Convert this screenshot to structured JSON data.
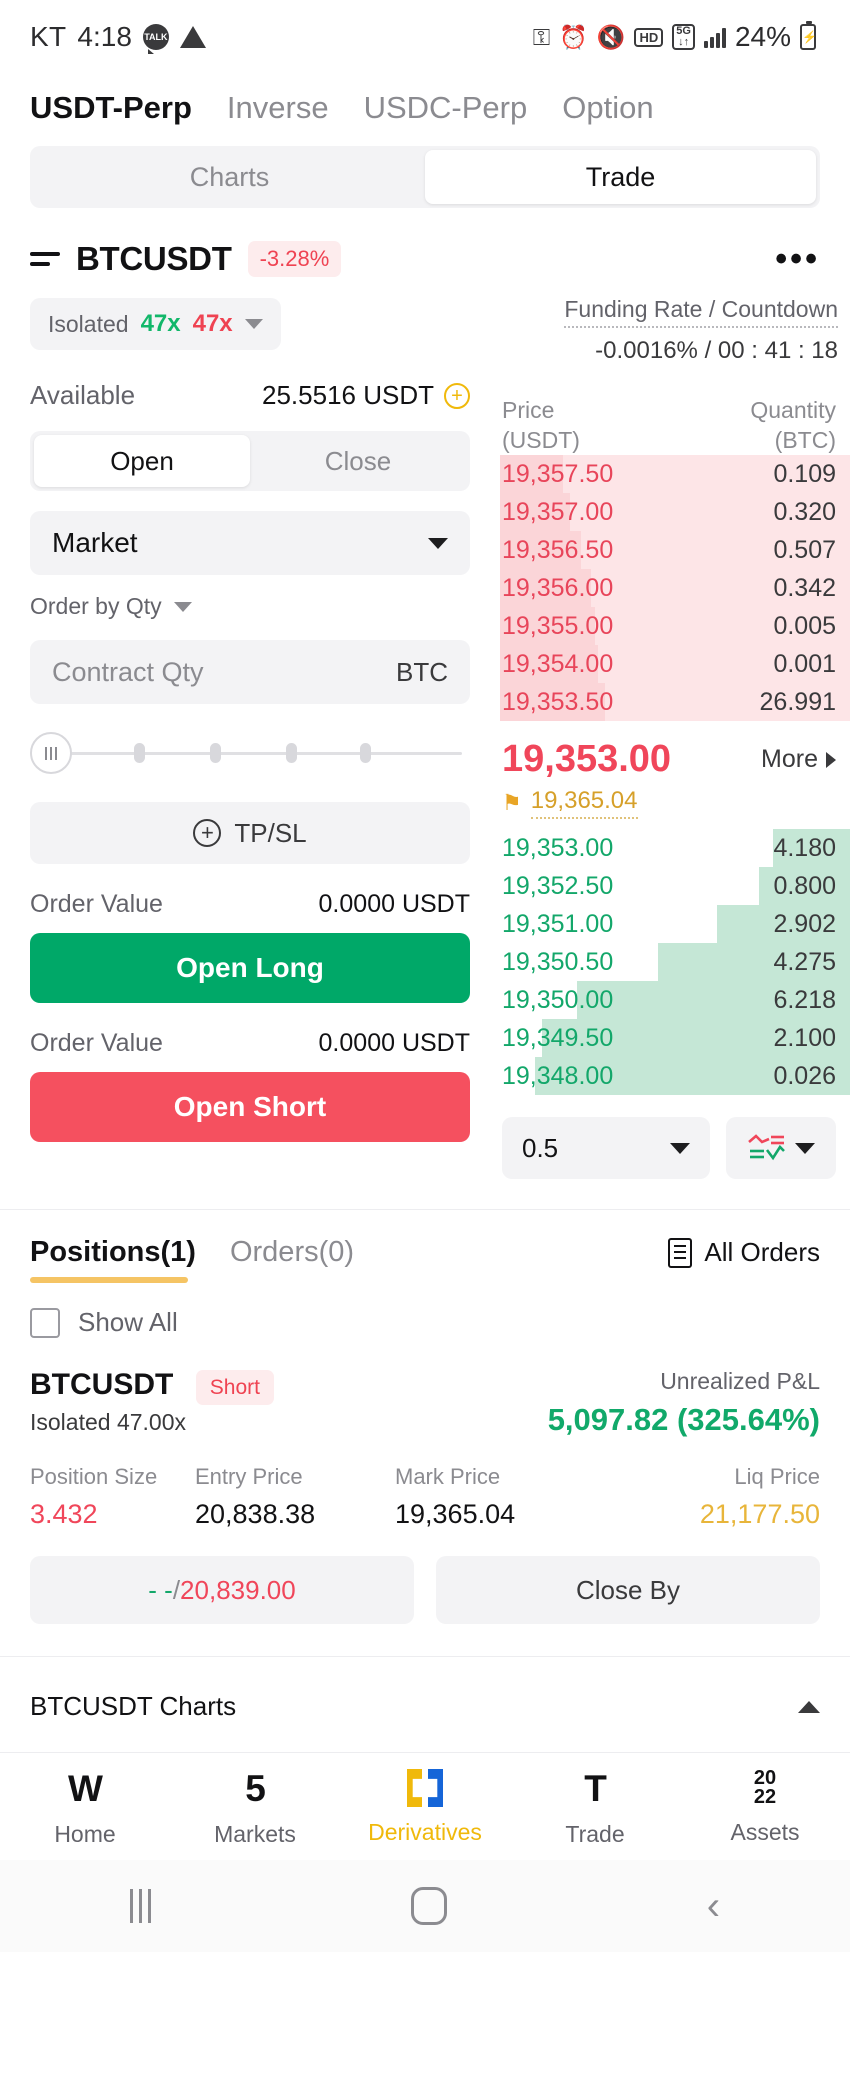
{
  "status_bar": {
    "carrier": "KT",
    "time": "4:18",
    "talk_icon_label": "TALK",
    "battery_percent": "24%",
    "icons": [
      "key-icon",
      "alarm-icon",
      "mute-icon",
      "hd-icon",
      "5g-icon",
      "signal-icon",
      "battery-charging-icon"
    ]
  },
  "top_tabs": [
    {
      "label": "USDT-Perp",
      "active": true
    },
    {
      "label": "Inverse",
      "active": false
    },
    {
      "label": "USDC-Perp",
      "active": false
    },
    {
      "label": "Option",
      "active": false
    }
  ],
  "view_switch": [
    {
      "label": "Charts",
      "active": false
    },
    {
      "label": "Trade",
      "active": true
    }
  ],
  "symbol": {
    "name": "BTCUSDT",
    "change": "-3.28%"
  },
  "leverage": {
    "margin_mode": "Isolated",
    "long_leverage": "47x",
    "short_leverage": "47x"
  },
  "funding": {
    "label": "Funding Rate / Countdown",
    "value": "-0.0016% / 00 : 41 : 18"
  },
  "available": {
    "label": "Available",
    "value": "25.5516 USDT"
  },
  "open_close": [
    {
      "label": "Open",
      "active": true
    },
    {
      "label": "Close",
      "active": false
    }
  ],
  "order_type": "Market",
  "order_by": "Order by Qty",
  "qty_field": {
    "placeholder": "Contract Qty",
    "unit": "BTC"
  },
  "tpsl_label": "TP/SL",
  "long_order": {
    "value_label": "Order Value",
    "value": "0.0000 USDT",
    "button": "Open Long"
  },
  "short_order": {
    "value_label": "Order Value",
    "value": "0.0000 USDT",
    "button": "Open Short"
  },
  "orderbook": {
    "price_header": "Price",
    "price_unit": "(USDT)",
    "qty_header": "Quantity",
    "qty_unit": "(BTC)",
    "asks": [
      {
        "price": "19,357.50",
        "qty": "0.109",
        "depth": 18
      },
      {
        "price": "19,357.00",
        "qty": "0.320",
        "depth": 20
      },
      {
        "price": "19,356.50",
        "qty": "0.507",
        "depth": 23
      },
      {
        "price": "19,356.00",
        "qty": "0.342",
        "depth": 26
      },
      {
        "price": "19,355.00",
        "qty": "0.005",
        "depth": 27
      },
      {
        "price": "19,354.00",
        "qty": "0.001",
        "depth": 28
      },
      {
        "price": "19,353.50",
        "qty": "26.991",
        "depth": 30
      }
    ],
    "last_price": "19,353.00",
    "mark_price": "19,365.04",
    "more_label": "More",
    "bids": [
      {
        "price": "19,353.00",
        "qty": "4.180",
        "depth": 22
      },
      {
        "price": "19,352.50",
        "qty": "0.800",
        "depth": 26
      },
      {
        "price": "19,351.00",
        "qty": "2.902",
        "depth": 38
      },
      {
        "price": "19,350.50",
        "qty": "4.275",
        "depth": 55
      },
      {
        "price": "19,350.00",
        "qty": "6.218",
        "depth": 78
      },
      {
        "price": "19,349.50",
        "qty": "2.100",
        "depth": 88
      },
      {
        "price": "19,348.00",
        "qty": "0.026",
        "depth": 90
      }
    ],
    "grouping": "0.5",
    "view_icon": "depth-view-icon"
  },
  "position_tabs": [
    {
      "label": "Positions(1)",
      "active": true
    },
    {
      "label": "Orders(0)",
      "active": false
    }
  ],
  "all_orders_label": "All Orders",
  "show_all_label": "Show All",
  "position": {
    "symbol": "BTCUSDT",
    "side": "Short",
    "margin": "Isolated 47.00x",
    "pnl_label": "Unrealized P&L",
    "pnl_value": "5,097.82 (325.64%)",
    "metrics": [
      {
        "header": "Position Size",
        "value": "3.432"
      },
      {
        "header": "Entry Price",
        "value": "20,838.38"
      },
      {
        "header": "Mark Price",
        "value": "19,365.04"
      },
      {
        "header": "Liq Price",
        "value": "21,177.50"
      }
    ],
    "tpsl_button_tp": "- -",
    "tpsl_button_sep": "/",
    "tpsl_button_sl": "20,839.00",
    "close_by_button": "Close By"
  },
  "chart_bar": {
    "label": "BTCUSDT Charts"
  },
  "bottom_nav": [
    {
      "label": "Home",
      "glyph": "W",
      "icon": "home-icon",
      "active": false
    },
    {
      "label": "Markets",
      "glyph": "5",
      "icon": "markets-icon",
      "active": false
    },
    {
      "label": "Derivatives",
      "glyph": "",
      "icon": "derivatives-icon",
      "active": true
    },
    {
      "label": "Trade",
      "glyph": "T",
      "icon": "trade-icon",
      "active": false
    },
    {
      "label": "Assets",
      "glyph": "",
      "icon": "assets-icon",
      "active": false,
      "stack_top": "20",
      "stack_bottom": "22"
    }
  ],
  "colors": {
    "up": "#13a76a",
    "down": "#f0465a",
    "accent": "#f0b90b",
    "liq": "#e8b53a"
  }
}
